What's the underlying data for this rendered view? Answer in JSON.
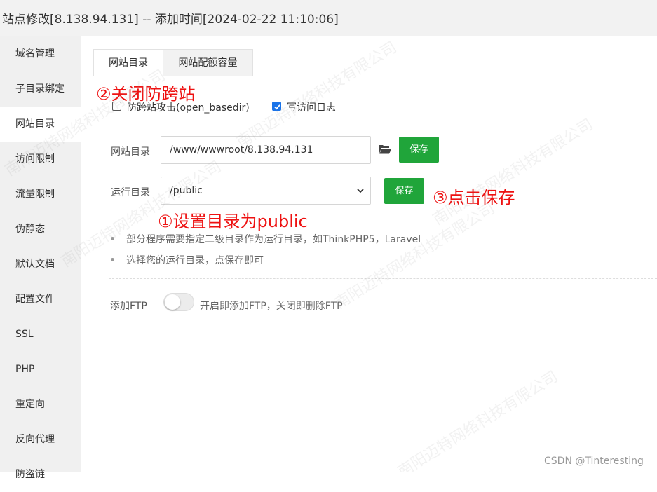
{
  "window": {
    "title": "站点修改[8.138.94.131] -- 添加时间[2024-02-22 11:10:06]"
  },
  "sidebar": {
    "items": [
      {
        "label": "域名管理"
      },
      {
        "label": "子目录绑定"
      },
      {
        "label": "网站目录"
      },
      {
        "label": "访问限制"
      },
      {
        "label": "流量限制"
      },
      {
        "label": "伪静态"
      },
      {
        "label": "默认文档"
      },
      {
        "label": "配置文件"
      },
      {
        "label": "SSL"
      },
      {
        "label": "PHP"
      },
      {
        "label": "重定向"
      },
      {
        "label": "反向代理"
      },
      {
        "label": "防盗链"
      }
    ],
    "active_index": 2
  },
  "tabs": [
    {
      "label": "网站目录",
      "active": true
    },
    {
      "label": "网站配额容量",
      "active": false
    }
  ],
  "annotations": {
    "step1": "①设置目录为public",
    "step2": "②关闭防跨站",
    "step3": "③点击保存"
  },
  "options": {
    "anti_cross_site": {
      "label": "防跨站攻击(open_basedir)",
      "checked": false
    },
    "write_log": {
      "label": "写访问日志",
      "checked": true
    }
  },
  "site_dir": {
    "label": "网站目录",
    "value": "/www/wwwroot/8.138.94.131",
    "save_label": "保存"
  },
  "run_dir": {
    "label": "运行目录",
    "value": "/public",
    "save_label": "保存"
  },
  "hints": [
    "部分程序需要指定二级目录作为运行目录，如ThinkPHP5，Laravel",
    "选择您的运行目录，点保存即可"
  ],
  "ftp": {
    "label": "添加FTP",
    "enabled": false,
    "description": "开启即添加FTP，关闭即删除FTP"
  },
  "watermark": "南阳迈特网络科技有限公司",
  "credit": "CSDN @Tinteresting",
  "colors": {
    "accent_green": "#20a53a",
    "annotation_red": "#ee1111",
    "checkbox_blue": "#1a73e8"
  }
}
